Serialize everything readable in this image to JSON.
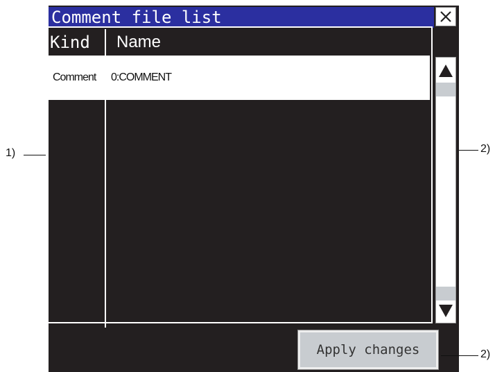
{
  "window": {
    "title": "Comment file list"
  },
  "table": {
    "columns": [
      "Kind",
      "Name"
    ],
    "rows": [
      {
        "kind": "Comment",
        "name": "0:COMMENT"
      }
    ]
  },
  "buttons": {
    "apply_label": "Apply changes"
  },
  "annotations": {
    "left": "1)",
    "right_scroll": "2)",
    "right_apply": "2)"
  },
  "icons": {
    "close": "close-icon",
    "scroll_up": "triangle-up-icon",
    "scroll_down": "triangle-down-icon"
  },
  "colors": {
    "titlebar": "#2b2fa0",
    "background": "#231f20",
    "selected_row": "#ffffff",
    "button": "#c8ccd0"
  }
}
